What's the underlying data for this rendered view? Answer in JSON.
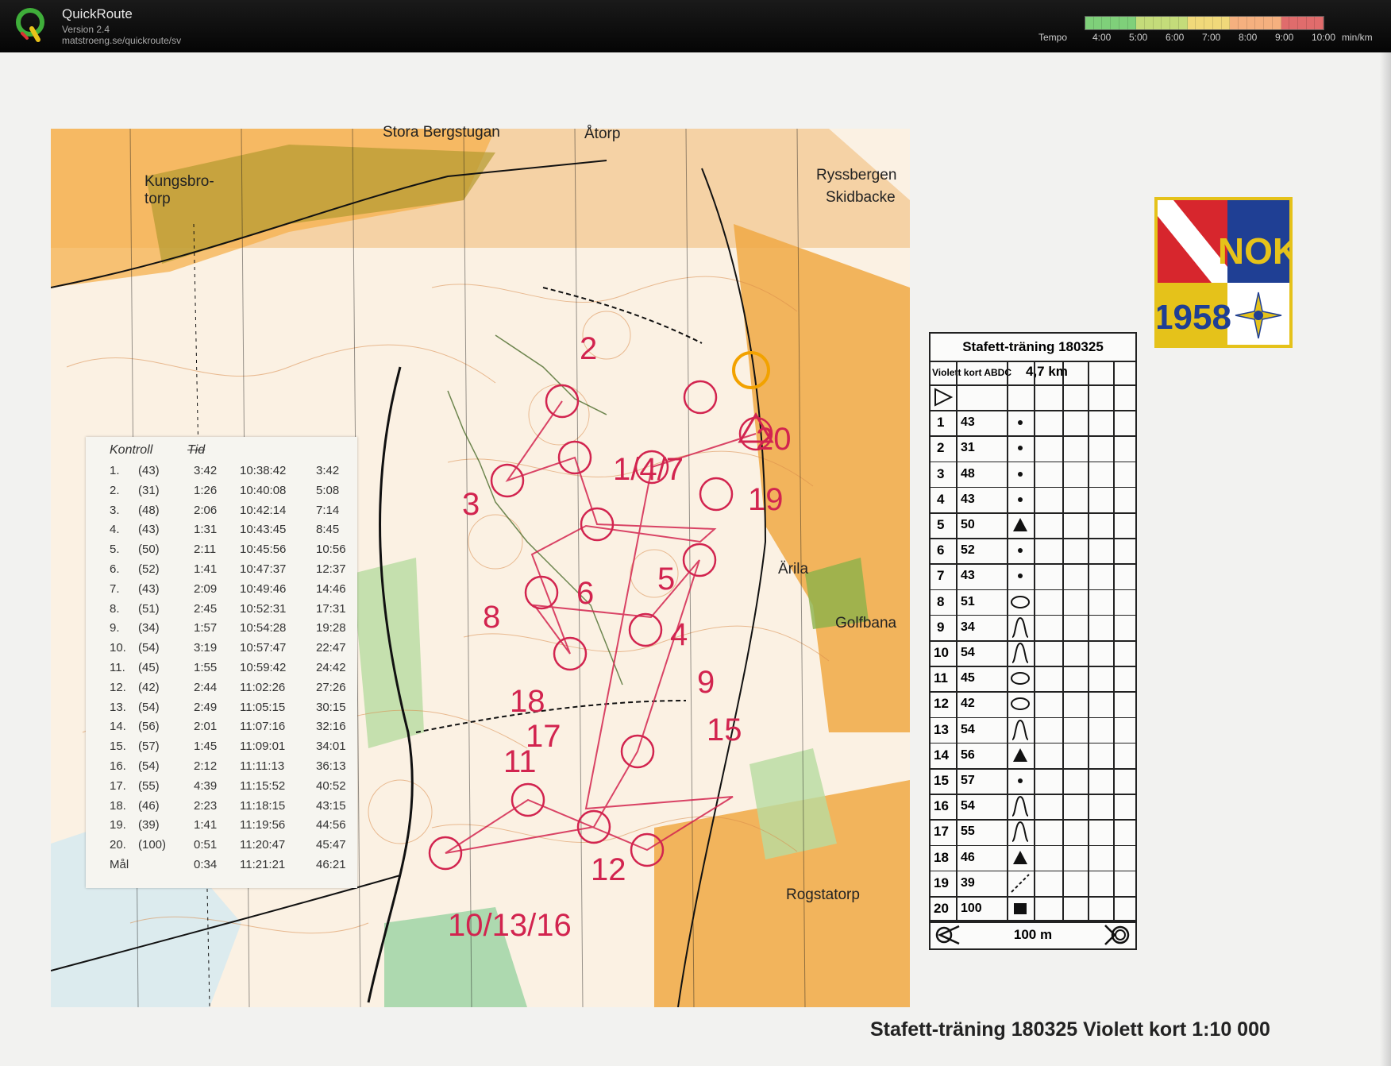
{
  "app": {
    "name": "QuickRoute",
    "version": "Version 2.4",
    "url": "matstroeng.se/quickroute/sv"
  },
  "tempo": {
    "label": "Tempo",
    "ticks": [
      "4:00",
      "5:00",
      "6:00",
      "7:00",
      "8:00",
      "9:00",
      "10:00"
    ],
    "unit": "min/km",
    "colors": [
      "#7fd07a",
      "#c4dc7a",
      "#f0d97a",
      "#f5b07f",
      "#e06c6c"
    ]
  },
  "map": {
    "places": {
      "stora_bergstugan": "Stora Bergstugan",
      "atorp": "Åtorp",
      "kungsbro1": "Kungsbro-",
      "kungsbro2": "torp",
      "ryssbergen1": "Ryssbergen",
      "ryssbergen2": "Skidbacke",
      "arila": "Ärila",
      "golfbana": "Golfbana",
      "rogstatorp": "Rogstatorp"
    },
    "control_labels": [
      "2",
      "3",
      "1/4/7",
      "20",
      "19",
      "5",
      "6",
      "8",
      "18",
      "17",
      "9",
      "11",
      "4",
      "12",
      "10/13/16",
      "15"
    ],
    "route_color": "#d2244f"
  },
  "splits": {
    "col_control": "Kontroll",
    "col_time": "Tid",
    "rows": [
      [
        "1.",
        "(43)",
        "3:42",
        "10:38:42",
        "3:42"
      ],
      [
        "2.",
        "(31)",
        "1:26",
        "10:40:08",
        "5:08"
      ],
      [
        "3.",
        "(48)",
        "2:06",
        "10:42:14",
        "7:14"
      ],
      [
        "4.",
        "(43)",
        "1:31",
        "10:43:45",
        "8:45"
      ],
      [
        "5.",
        "(50)",
        "2:11",
        "10:45:56",
        "10:56"
      ],
      [
        "6.",
        "(52)",
        "1:41",
        "10:47:37",
        "12:37"
      ],
      [
        "7.",
        "(43)",
        "2:09",
        "10:49:46",
        "14:46"
      ],
      [
        "8.",
        "(51)",
        "2:45",
        "10:52:31",
        "17:31"
      ],
      [
        "9.",
        "(34)",
        "1:57",
        "10:54:28",
        "19:28"
      ],
      [
        "10.",
        "(54)",
        "3:19",
        "10:57:47",
        "22:47"
      ],
      [
        "11.",
        "(45)",
        "1:55",
        "10:59:42",
        "24:42"
      ],
      [
        "12.",
        "(42)",
        "2:44",
        "11:02:26",
        "27:26"
      ],
      [
        "13.",
        "(54)",
        "2:49",
        "11:05:15",
        "30:15"
      ],
      [
        "14.",
        "(56)",
        "2:01",
        "11:07:16",
        "32:16"
      ],
      [
        "15.",
        "(57)",
        "1:45",
        "11:09:01",
        "34:01"
      ],
      [
        "16.",
        "(54)",
        "2:12",
        "11:11:13",
        "36:13"
      ],
      [
        "17.",
        "(55)",
        "4:39",
        "11:15:52",
        "40:52"
      ],
      [
        "18.",
        "(46)",
        "2:23",
        "11:18:15",
        "43:15"
      ],
      [
        "19.",
        "(39)",
        "1:41",
        "11:19:56",
        "44:56"
      ],
      [
        "20.",
        "(100)",
        "0:51",
        "11:20:47",
        "45:47"
      ],
      [
        "Mål",
        "",
        "0:34",
        "11:21:21",
        "46:21"
      ]
    ]
  },
  "logo": {
    "text_top": "NOK",
    "text_bottom": "1958"
  },
  "description": {
    "title": "Stafett-träning 180325",
    "class": "Violett kort ABDC",
    "length": "4,7 km",
    "controls": [
      [
        "1",
        "43",
        "dot"
      ],
      [
        "2",
        "31",
        "dot"
      ],
      [
        "3",
        "48",
        "dot"
      ],
      [
        "4",
        "43",
        "dot"
      ],
      [
        "5",
        "50",
        "triangle"
      ],
      [
        "6",
        "52",
        "dot"
      ],
      [
        "7",
        "43",
        "dot"
      ],
      [
        "8",
        "51",
        "oval"
      ],
      [
        "9",
        "34",
        "knoll"
      ],
      [
        "10",
        "54",
        "knoll"
      ],
      [
        "11",
        "45",
        "oval"
      ],
      [
        "12",
        "42",
        "oval"
      ],
      [
        "13",
        "54",
        "knoll"
      ],
      [
        "14",
        "56",
        "triangle"
      ],
      [
        "15",
        "57",
        "dot"
      ],
      [
        "16",
        "54",
        "knoll"
      ],
      [
        "17",
        "55",
        "knoll"
      ],
      [
        "18",
        "46",
        "triangle"
      ],
      [
        "19",
        "39",
        "dash"
      ],
      [
        "20",
        "100",
        "square"
      ]
    ],
    "footer": "100 m"
  },
  "caption": "Stafett-träning 180325 Violett kort 1:10 000"
}
